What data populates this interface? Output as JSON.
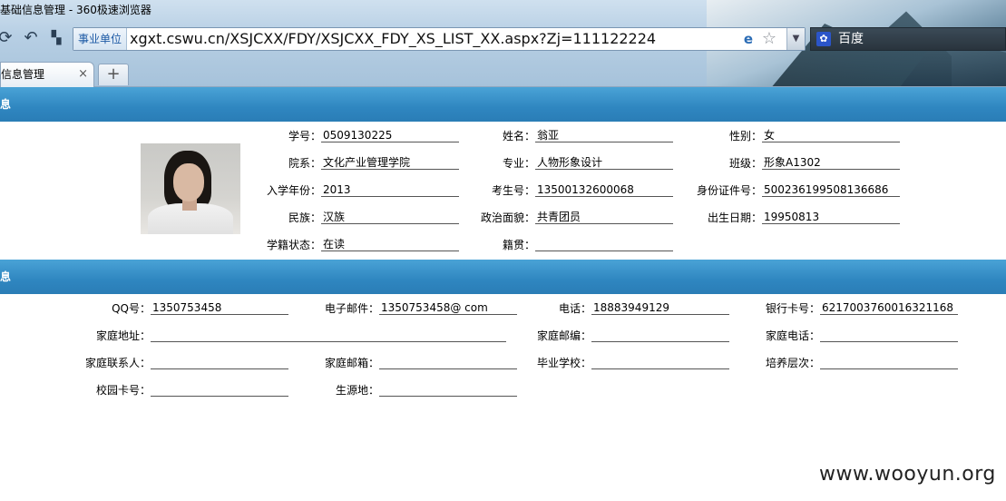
{
  "browser": {
    "window_title": "基础信息管理 - 360极速浏览器",
    "address_zone": "事业单位",
    "url": "xgxt.cswu.cn/XSJCXX/FDY/XSJCXX_FDY_XS_LIST_XX.aspx?Zj=111122224",
    "search_engine": "百度",
    "tab_title": "基础信息管理",
    "tab_close": "×",
    "new_tab": "+",
    "icons": {
      "refresh": "refresh-icon",
      "undo": "undo-icon",
      "apps": "apps-icon",
      "ie_compat": "ie-icon",
      "favorite": "star-icon",
      "dropdown": "chevron-down-icon",
      "baidu": "paw-icon"
    }
  },
  "sections": {
    "basic_title": "基本信息",
    "contact_title": "联系信息"
  },
  "basic": {
    "student_no": {
      "label": "学号：",
      "value": "0509130225"
    },
    "name": {
      "label": "姓名：",
      "value": "翁亚"
    },
    "gender": {
      "label": "性别：",
      "value": "女"
    },
    "department": {
      "label": "院系：",
      "value": "文化产业管理学院"
    },
    "major": {
      "label": "专业：",
      "value": "人物形象设计"
    },
    "class": {
      "label": "班级：",
      "value": "形象A1302"
    },
    "enroll_year": {
      "label": "入学年份：",
      "value": "2013"
    },
    "exam_no": {
      "label": "考生号：",
      "value": "13500132600068"
    },
    "id_no": {
      "label": "身份证件号：",
      "value": "500236199508136686"
    },
    "ethnicity": {
      "label": "民族：",
      "value": "汉族"
    },
    "political": {
      "label": "政治面貌：",
      "value": "共青团员"
    },
    "birth": {
      "label": "出生日期：",
      "value": "19950813"
    },
    "status": {
      "label": "学籍状态：",
      "value": "在读"
    },
    "native": {
      "label": "籍贯：",
      "value": ""
    }
  },
  "contact": {
    "qq": {
      "label": "QQ号：",
      "value": "1350753458"
    },
    "email": {
      "label": "电子邮件：",
      "value": "1350753458@ com"
    },
    "phone": {
      "label": "电话：",
      "value": "18883949129"
    },
    "bank": {
      "label": "银行卡号：",
      "value": "6217003760016321168"
    },
    "home_addr": {
      "label": "家庭地址：",
      "value": ""
    },
    "home_zip": {
      "label": "家庭邮编：",
      "value": ""
    },
    "home_phone": {
      "label": "家庭电话：",
      "value": ""
    },
    "home_contact": {
      "label": "家庭联系人：",
      "value": ""
    },
    "home_email": {
      "label": "家庭邮箱：",
      "value": ""
    },
    "school": {
      "label": "毕业学校：",
      "value": ""
    },
    "level": {
      "label": "培养层次：",
      "value": ""
    },
    "campus_card": {
      "label": "校园卡号：",
      "value": ""
    },
    "origin": {
      "label": "生源地：",
      "value": ""
    }
  },
  "watermark": "www.wooyun.org",
  "colors": {
    "section_bar": "#2f86c0",
    "chrome": "#b7cfe4"
  }
}
